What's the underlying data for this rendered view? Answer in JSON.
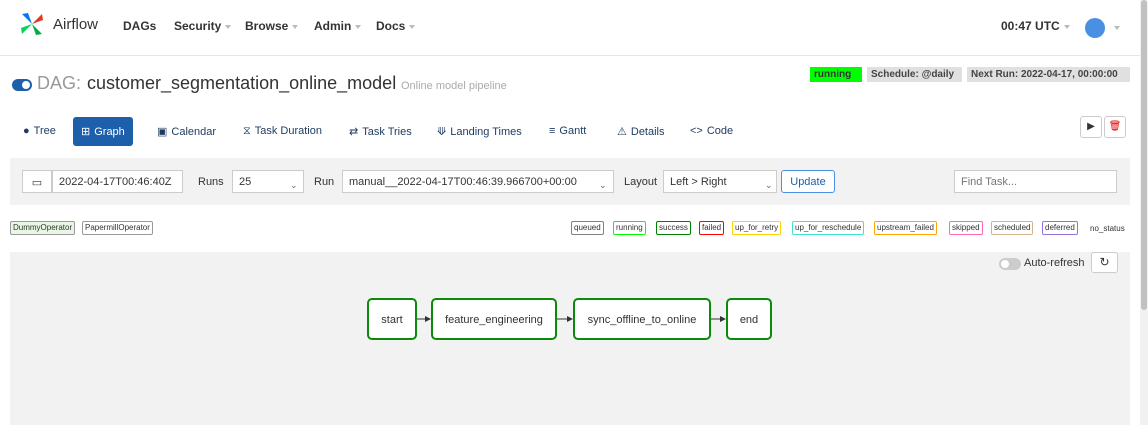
{
  "navbar": {
    "brand": "Airflow",
    "items": [
      {
        "label": "DAGs"
      },
      {
        "label": "Security"
      },
      {
        "label": "Browse"
      },
      {
        "label": "Admin"
      },
      {
        "label": "Docs"
      }
    ],
    "clock": "00:47 UTC"
  },
  "dag": {
    "prefix": "DAG:",
    "name": "customer_segmentation_online_model",
    "description": "Online model pipeline",
    "state": "running",
    "schedule": "Schedule: @daily",
    "next_run": "Next Run: 2022-04-17, 00:00:00"
  },
  "tabs": [
    {
      "label": "Tree",
      "icon": "tree-icon"
    },
    {
      "label": "Graph",
      "icon": "graph-icon"
    },
    {
      "label": "Calendar",
      "icon": "calendar-icon"
    },
    {
      "label": "Task Duration",
      "icon": "hourglass-icon"
    },
    {
      "label": "Task Tries",
      "icon": "retry-icon"
    },
    {
      "label": "Landing Times",
      "icon": "landing-icon"
    },
    {
      "label": "Gantt",
      "icon": "gantt-icon"
    },
    {
      "label": "Details",
      "icon": "details-icon"
    },
    {
      "label": "Code",
      "icon": "code-icon"
    }
  ],
  "controls": {
    "base_date": "2022-04-17T00:46:40Z",
    "runs_label": "Runs",
    "runs_value": "25",
    "run_label": "Run",
    "run_value": "manual__2022-04-17T00:46:39.966700+00:00",
    "layout_label": "Layout",
    "layout_value": "Left > Right",
    "update_label": "Update",
    "find_placeholder": "Find Task..."
  },
  "operators": [
    "DummyOperator",
    "PapermillOperator"
  ],
  "legend": [
    {
      "label": "queued",
      "color": "#808080"
    },
    {
      "label": "running",
      "color": "#00ff00"
    },
    {
      "label": "success",
      "color": "#008000"
    },
    {
      "label": "failed",
      "color": "#ff0000"
    },
    {
      "label": "up_for_retry",
      "color": "#ffd700"
    },
    {
      "label": "up_for_reschedule",
      "color": "#40e0d0"
    },
    {
      "label": "upstream_failed",
      "color": "#ffa500"
    },
    {
      "label": "skipped",
      "color": "#ff69b4"
    },
    {
      "label": "scheduled",
      "color": "#d2b48c"
    },
    {
      "label": "deferred",
      "color": "#9370db"
    }
  ],
  "legend_no_status": "no_status",
  "graph": {
    "auto_refresh_label": "Auto-refresh",
    "nodes": [
      "start",
      "feature_engineering",
      "sync_offline_to_online",
      "end"
    ]
  }
}
